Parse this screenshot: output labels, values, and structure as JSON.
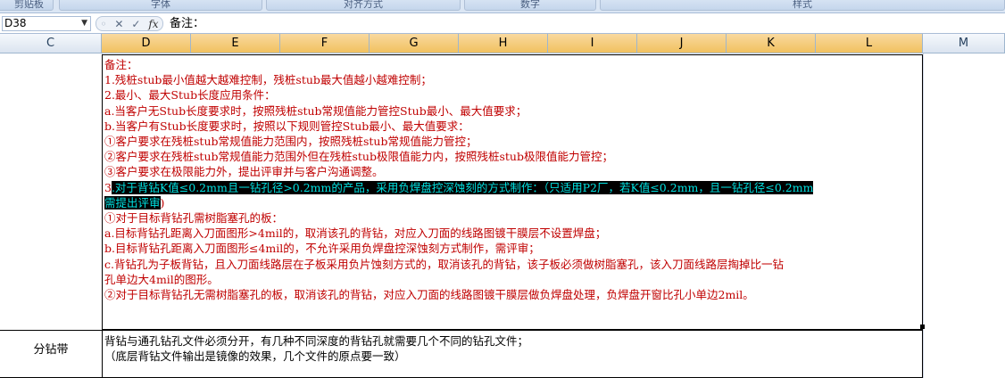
{
  "ribbon": {
    "groups": [
      "剪贴板",
      "字体",
      "对齐方式",
      "数字",
      "样式"
    ]
  },
  "formula_bar": {
    "name_box": "D38",
    "fx": "fx",
    "content": "备注："
  },
  "columns": [
    "C",
    "D",
    "E",
    "F",
    "G",
    "H",
    "I",
    "J",
    "K",
    "L",
    "M"
  ],
  "notes_cell": {
    "lines": [
      "备注：",
      "1.残桩stub最小值越大越难控制，残桩stub最大值越小越难控制；",
      "2.最小、最大Stub长度应用条件：",
      "a.当客户无Stub长度要求时，按照残桩stub常规值能力管控Stub最小、最大值要求；",
      "b.当客户有Stub长度要求时，按照以下规则管控Stub最小、最大值要求：",
      "①客户要求在残桩stub常规值能力范围内，按照残桩stub常规值能力管控；",
      "②客户要求在残桩stub常规值能力范围外但在残桩stub极限值能力内，按照残桩stub极限值能力管控；",
      "③客户要求在极限能力外，提出评审并与客户沟通调整。"
    ],
    "highlight_prefix": "3",
    "highlight_text": ".对于背钻K值≤0.2mm且一钻孔径>0.2mm的产品，采用负焊盘控深蚀刻的方式制作：（只适用P2厂，若K值≤0.2mm，且一钻孔径≤0.2mm",
    "highlight_cont": "需提出评审",
    "highlight_end": ")",
    "lines_after": [
      "①对于目标背钻孔需树脂塞孔的板：",
      "a.目标背钻孔距离入刀面图形>4mil的，取消该孔的背钻，对应入刀面的线路图镀干膜层不设置焊盘；",
      "b.目标背钻孔距离入刀面图形≤4mil的，不允许采用负焊盘控深蚀刻方式制作，需评审；",
      "c.背钻孔为子板背钻，且入刀面线路层在子板采用负片蚀刻方式的，取消该孔的背钻，该子板必须做树脂塞孔，该入刀面线路层掏掉比一钻",
      "孔单边大4mil的图形。",
      "②对于目标背钻孔无需树脂塞孔的板，取消该孔的背钻，对应入刀面的线路图镀干膜层做负焊盘处理，负焊盘开窗比孔小单边2mil。"
    ]
  },
  "row2": {
    "label": "分钻带",
    "lines": [
      "背钻与通孔钻孔文件必须分开，有几种不同深度的背钻孔就需要几个不同的钻孔文件；",
      "（底层背钻文件输出是镜像的效果，几个文件的原点要一致）"
    ]
  },
  "colors": {
    "note_text": "#c00000",
    "highlight_bg": "#000000",
    "highlight_text": "#00e0e0",
    "selected_column": "#f1c15f"
  }
}
